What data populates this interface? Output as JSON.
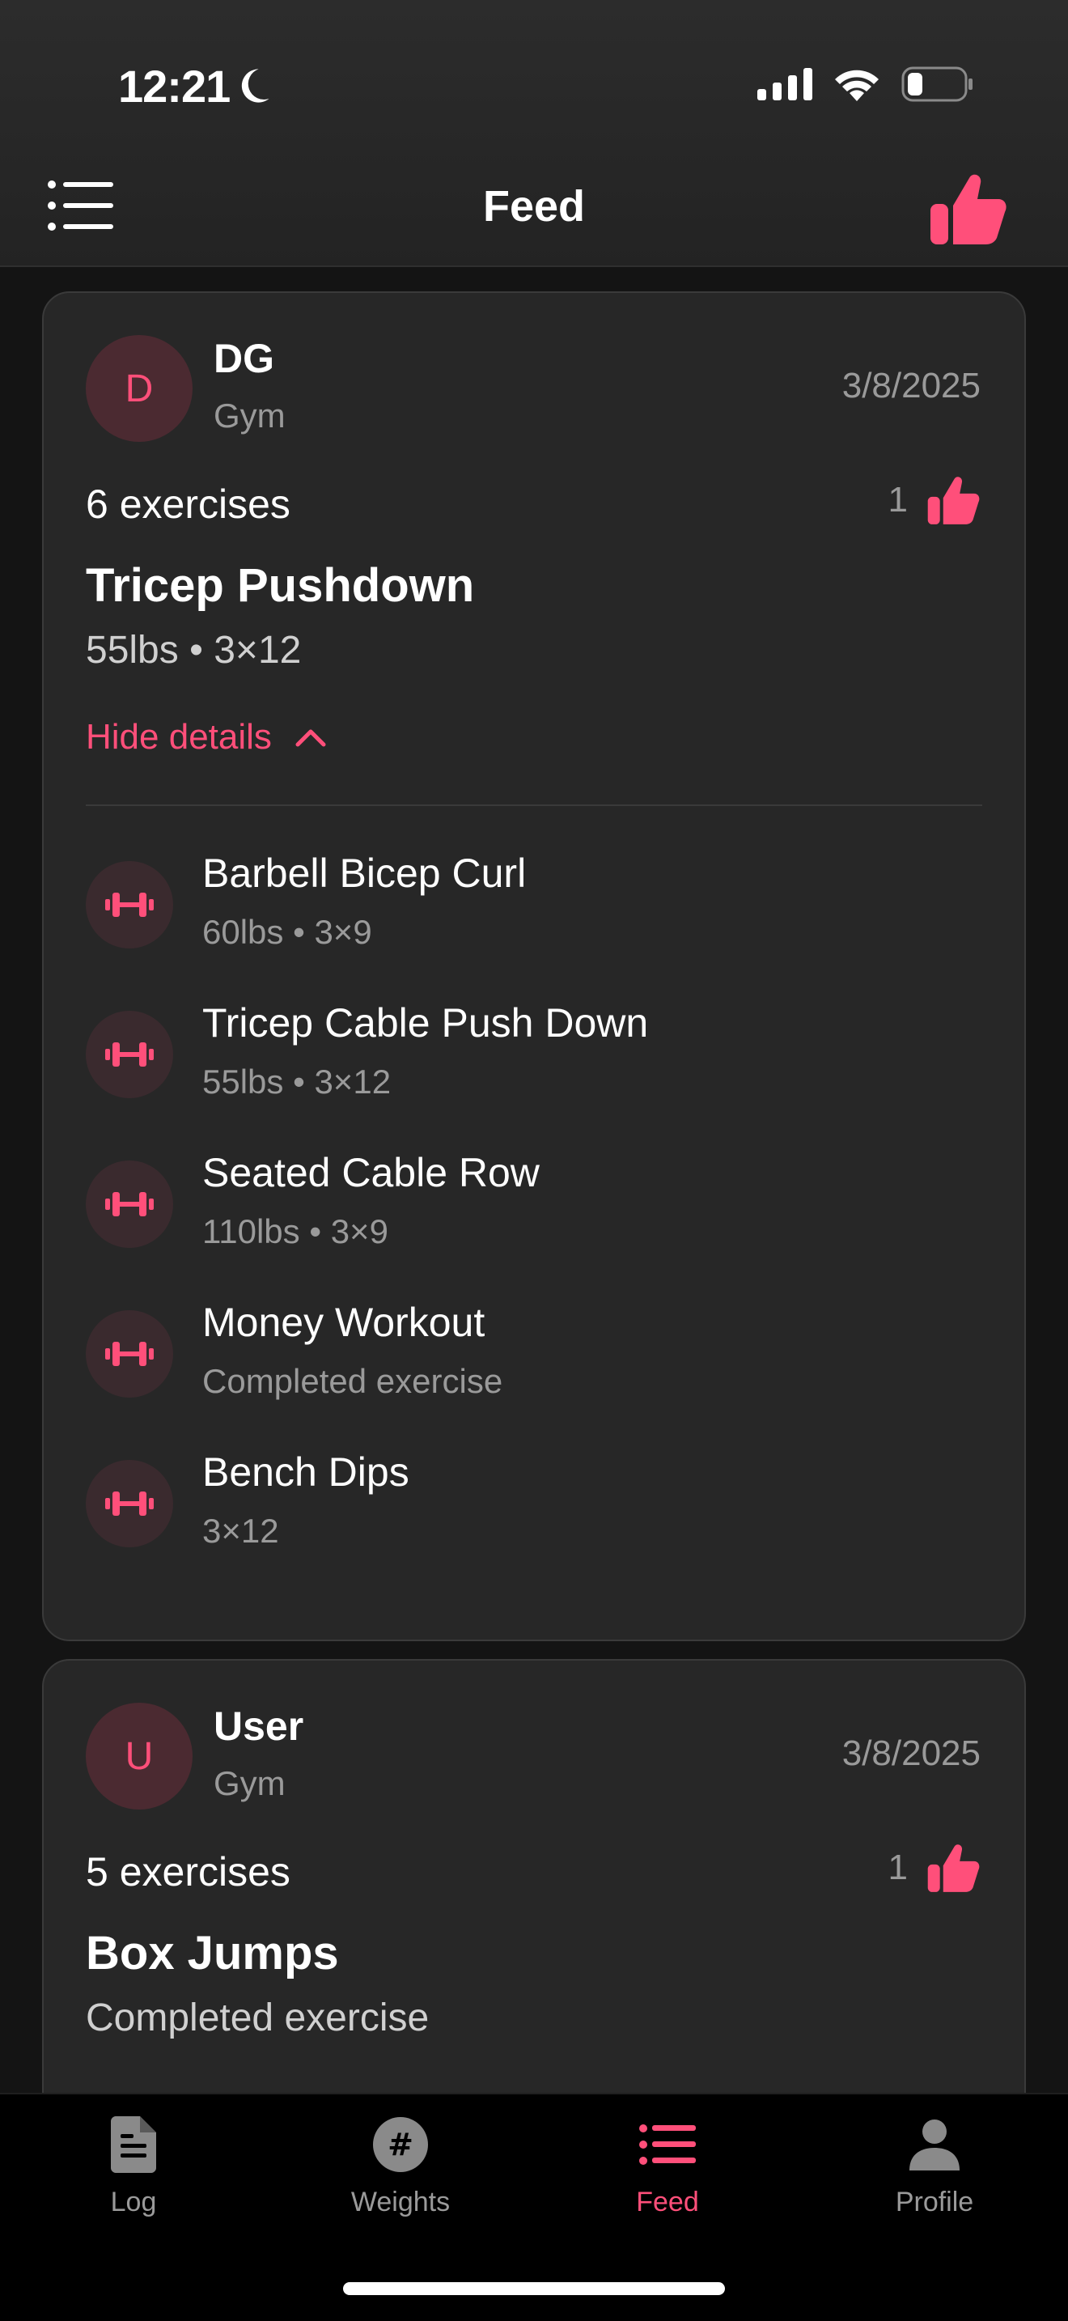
{
  "status_bar": {
    "time": "12:21"
  },
  "nav": {
    "title": "Feed"
  },
  "posts": [
    {
      "avatar_letter": "D",
      "user": "DG",
      "location": "Gym",
      "date": "3/8/2025",
      "exercise_count": "6 exercises",
      "likes": "1",
      "main_exercise": "Tricep Pushdown",
      "main_meta": "55lbs • 3×12",
      "toggle_label": "Hide details",
      "exercises": [
        {
          "name": "Barbell Bicep Curl",
          "meta": "60lbs • 3×9"
        },
        {
          "name": "Tricep Cable Push Down",
          "meta": "55lbs • 3×12"
        },
        {
          "name": "Seated Cable Row",
          "meta": "110lbs • 3×9"
        },
        {
          "name": "Money Workout",
          "meta": "Completed exercise"
        },
        {
          "name": "Bench Dips",
          "meta": "3×12"
        }
      ]
    },
    {
      "avatar_letter": "U",
      "user": "User",
      "location": "Gym",
      "date": "3/8/2025",
      "exercise_count": "5 exercises",
      "likes": "1",
      "main_exercise": "Box Jumps",
      "main_meta": "Completed exercise"
    }
  ],
  "tabs": [
    {
      "label": "Log",
      "icon": "document-icon"
    },
    {
      "label": "Weights",
      "icon": "hash-icon"
    },
    {
      "label": "Feed",
      "icon": "list-icon",
      "active": true
    },
    {
      "label": "Profile",
      "icon": "person-icon"
    }
  ],
  "colors": {
    "accent": "#ff4f7a",
    "card": "#272727",
    "background": "#141414"
  }
}
